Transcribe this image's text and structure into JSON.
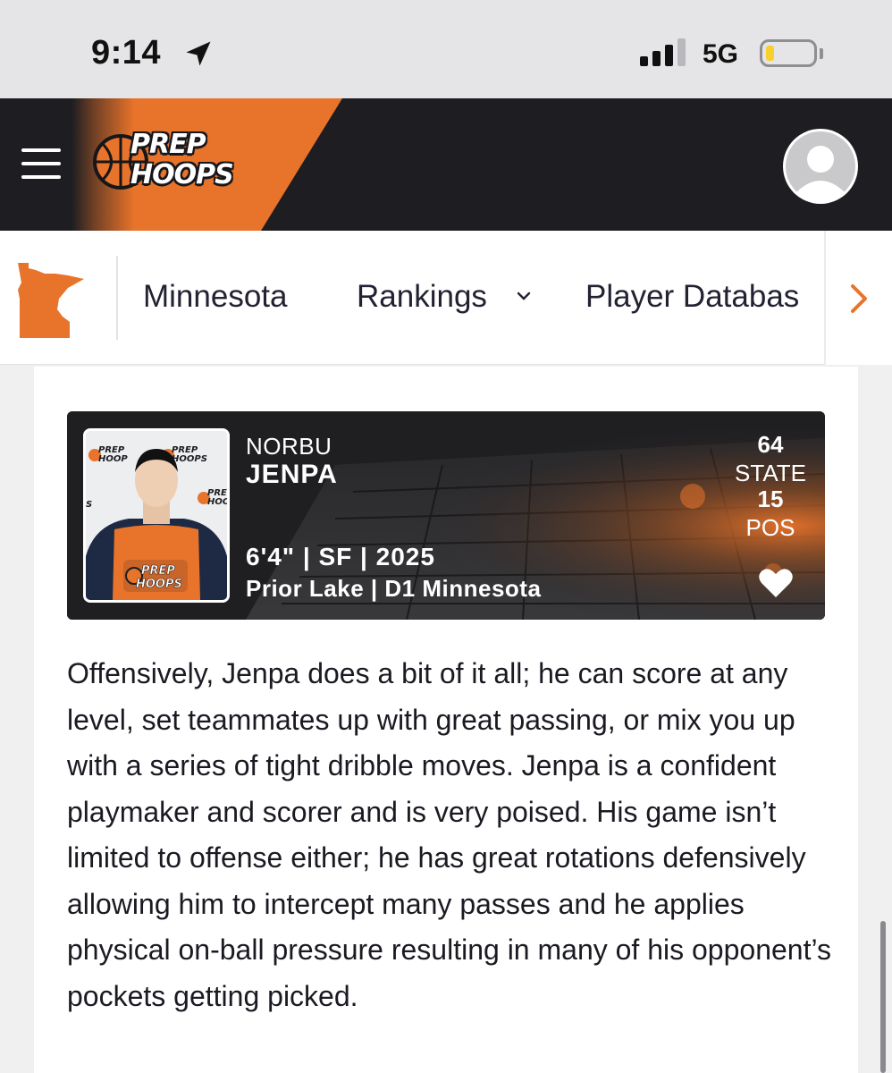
{
  "status_bar": {
    "time": "9:14",
    "network": "5G",
    "battery_level": 0.15,
    "signal_bars": 3
  },
  "header": {
    "logo_line1": "PREP",
    "logo_line2": "HOOPS",
    "brand_color": "#e8732a"
  },
  "sub_nav": {
    "items": [
      {
        "label": "Minnesota"
      },
      {
        "label": "Rankings"
      },
      {
        "label": "Player Databas"
      }
    ]
  },
  "player": {
    "first_name": "NORBU",
    "last_name": "JENPA",
    "details_line1": "6'4\" | SF | 2025",
    "details_line2": "Prior Lake | D1 Minnesota",
    "state_rank": "64",
    "state_label": "STATE",
    "pos_rank": "15",
    "pos_label": "POS",
    "photo_logo_line1": "PREP",
    "photo_logo_line2": "HOOPS"
  },
  "article": {
    "paragraph": "Offensively, Jenpa does a bit of it all; he can score at any level, set teammates up with great passing, or mix you up with a series of tight dribble moves. Jenpa is a confident playmaker and scorer and is very poised. His game isn’t limited to offense either; he has great rotations defensively allowing him to intercept many passes and he applies physical on-ball pressure resulting in many of his opponent’s pockets getting picked."
  }
}
